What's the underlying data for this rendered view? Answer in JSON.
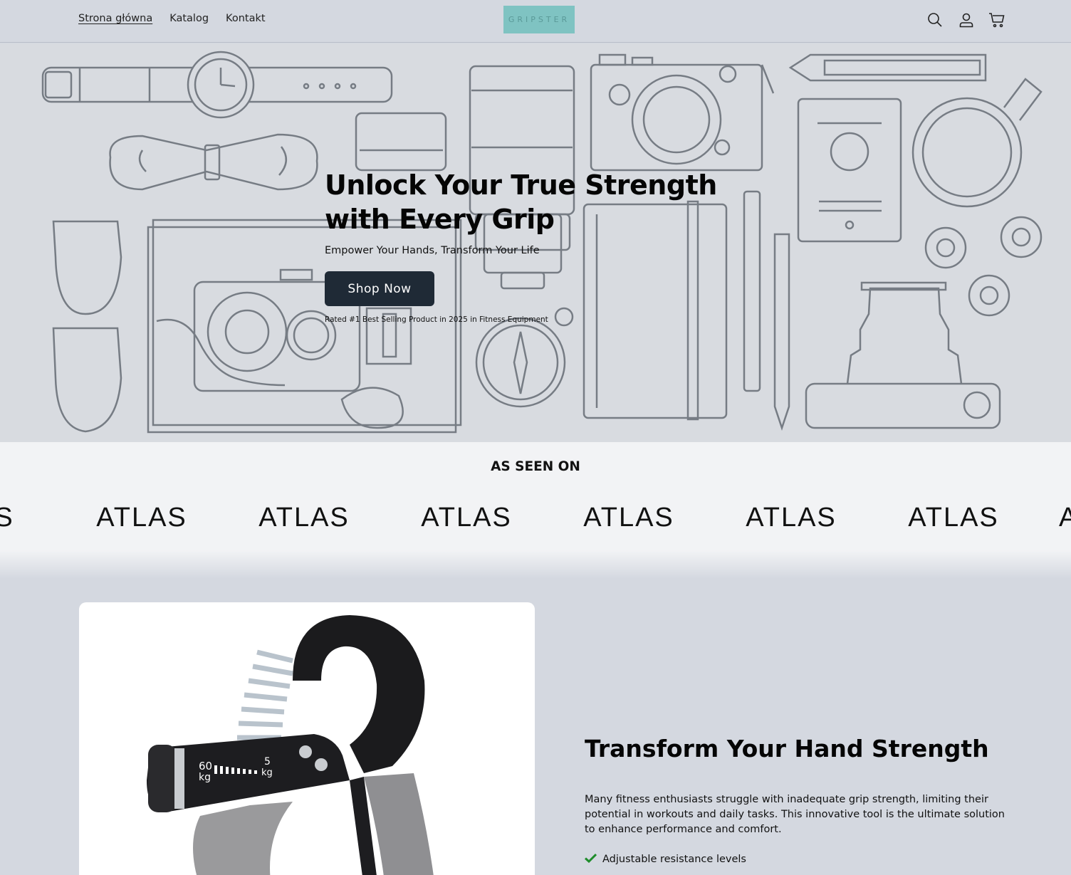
{
  "header": {
    "nav": [
      "Strona główna",
      "Katalog",
      "Kontakt"
    ],
    "logo_text": "GRIPSTER",
    "icons": [
      "search-icon",
      "account-icon",
      "cart-icon"
    ]
  },
  "hero": {
    "title": "Unlock Your True Strength with Every Grip",
    "subtitle": "Empower Your Hands, Transform Your Life",
    "cta_label": "Shop Now",
    "rated": "Rated #1 Best Selling Product in 2025 in Fitness Equipment"
  },
  "seen_on": {
    "title": "AS SEEN ON",
    "logos": [
      "ATLAS",
      "ATLAS",
      "ATLAS",
      "ATLAS",
      "ATLAS",
      "ATLAS",
      "ATLAS",
      "ATLAS"
    ]
  },
  "feature": {
    "title": "Transform Your Hand Strength",
    "description": "Many fitness enthusiasts struggle with inadequate grip strength, limiting their potential in workouts and daily tasks. This innovative tool is the ultimate solution to enhance performance and comfort.",
    "bullets": [
      "Adjustable resistance levels"
    ],
    "gauge_labels": {
      "max": "60",
      "max_unit": "kg",
      "min": "5",
      "min_unit": "kg"
    }
  },
  "colors": {
    "header_bg": "#d4d8e0",
    "logo_bg": "#7fc3c2",
    "cta_bg": "#1f2a36",
    "check": "#1e8c2a"
  }
}
